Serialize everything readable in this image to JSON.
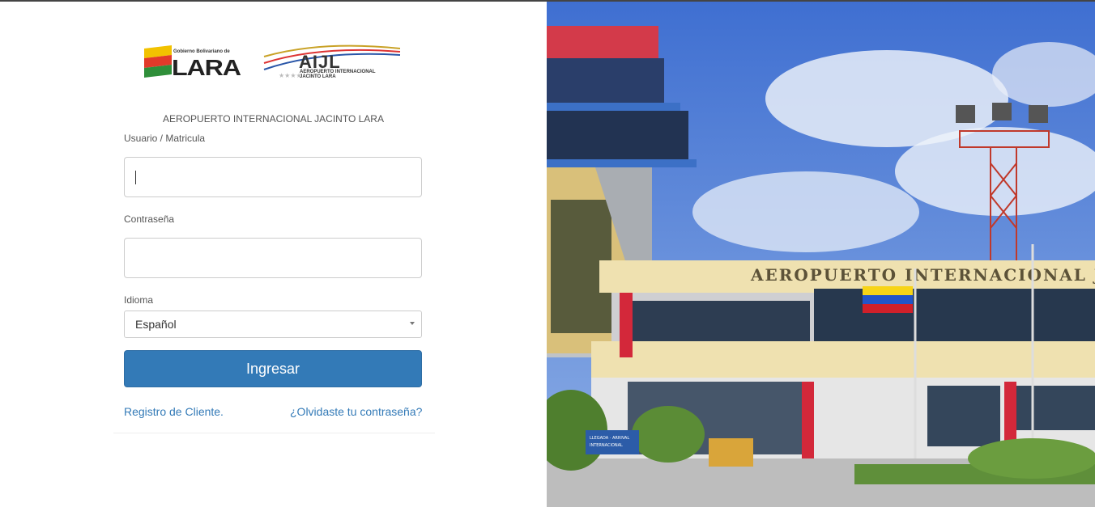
{
  "logo": {
    "lara_small": "Gobierno Bolivariano de",
    "lara_word": "LARA",
    "aijl_word": "AIJL",
    "aijl_sub_line1": "AEROPUERTO INTERNACIONAL",
    "aijl_sub_line2": "JACINTO LARA"
  },
  "form": {
    "heading": "AEROPUERTO INTERNACIONAL JACINTO LARA",
    "username_label": "Usuario / Matricula",
    "username_value": "",
    "password_label": "Contraseña",
    "password_value": "",
    "language_label": "Idioma",
    "language_selected": "Español",
    "submit_label": "Ingresar",
    "register_link": "Registro de Cliente.",
    "forgot_link": "¿Olvidaste tu contraseña?"
  },
  "photo": {
    "building_sign": "AEROPUERTO INTERNACIONAL J",
    "road_sign_line1": "LLEGADA · ARRIVAL",
    "road_sign_line2": "INTERNACIONAL"
  },
  "colors": {
    "primary_button": "#337ab7",
    "link": "#337ab7",
    "sky": "#5a86d6"
  }
}
